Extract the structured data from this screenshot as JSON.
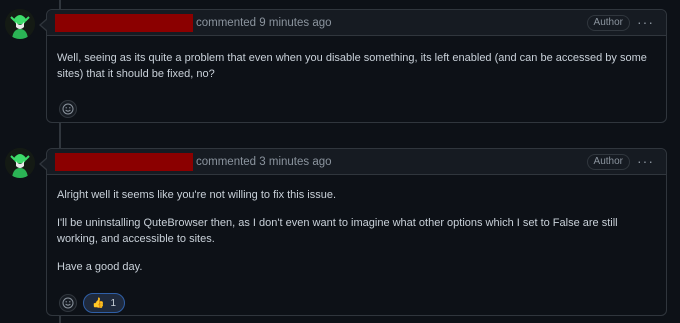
{
  "comments": [
    {
      "meta": "commented 9 minutes ago",
      "badge": "Author",
      "menu_icon": "···",
      "paragraphs": [
        "Well, seeing as its quite a problem that even when you disable something, its left enabled (and can be accessed by some sites) that it should be fixed, no?"
      ],
      "reactions": []
    },
    {
      "meta": "commented 3 minutes ago",
      "badge": "Author",
      "menu_icon": "···",
      "paragraphs": [
        "Alright well it seems like you're not willing to fix this issue.",
        "I'll be uninstalling QuteBrowser then, as I don't even want to imagine what other options which I set to False are still working, and accessible to sites.",
        "Have a good day."
      ],
      "reactions": [
        {
          "icon": "👍",
          "count": "1"
        }
      ]
    }
  ],
  "colors": {
    "redaction": "#8b0000",
    "background": "#0d1117",
    "header": "#161b22",
    "border": "#30363d"
  }
}
